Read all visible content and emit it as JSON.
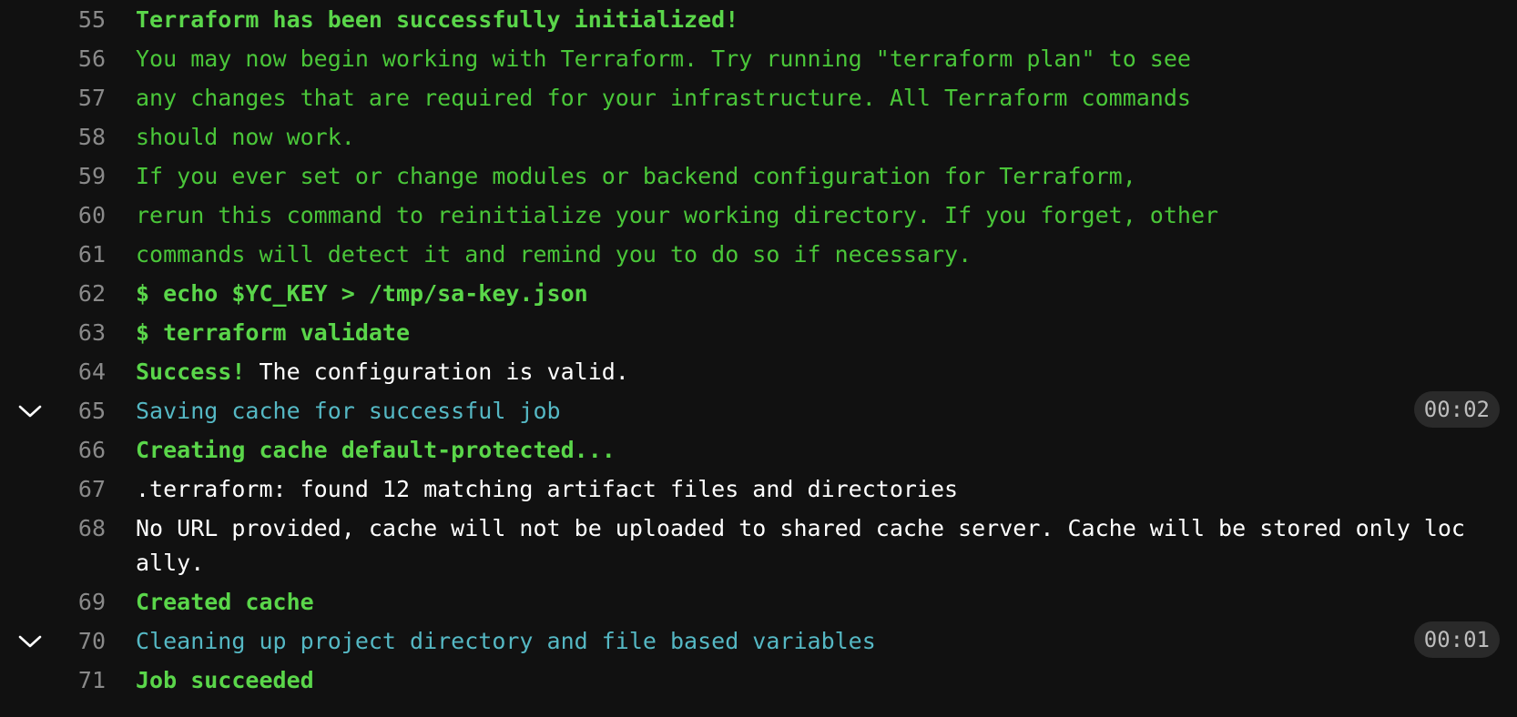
{
  "log": {
    "lines": [
      {
        "num": "55",
        "segments": [
          {
            "text": "Terraform has been successfully initialized!",
            "style": "green-bold"
          }
        ]
      },
      {
        "num": "56",
        "segments": [
          {
            "text": "You may now begin working with Terraform. Try running \"terraform plan\" to see",
            "style": "green"
          }
        ]
      },
      {
        "num": "57",
        "segments": [
          {
            "text": "any changes that are required for your infrastructure. All Terraform commands",
            "style": "green"
          }
        ]
      },
      {
        "num": "58",
        "segments": [
          {
            "text": "should now work.",
            "style": "green"
          }
        ]
      },
      {
        "num": "59",
        "segments": [
          {
            "text": "If you ever set or change modules or backend configuration for Terraform,",
            "style": "green"
          }
        ]
      },
      {
        "num": "60",
        "segments": [
          {
            "text": "rerun this command to reinitialize your working directory. If you forget, other",
            "style": "green"
          }
        ]
      },
      {
        "num": "61",
        "segments": [
          {
            "text": "commands will detect it and remind you to do so if necessary.",
            "style": "green"
          }
        ]
      },
      {
        "num": "62",
        "segments": [
          {
            "text": "$ echo $YC_KEY > /tmp/sa-key.json",
            "style": "green-bold"
          }
        ]
      },
      {
        "num": "63",
        "segments": [
          {
            "text": "$ terraform validate",
            "style": "green-bold"
          }
        ]
      },
      {
        "num": "64",
        "segments": [
          {
            "text": "Success!",
            "style": "green-bold"
          },
          {
            "text": " The configuration is valid.",
            "style": "white"
          }
        ]
      },
      {
        "num": "65",
        "collapsible": true,
        "duration": "00:02",
        "segments": [
          {
            "text": "Saving cache for successful job",
            "style": "cyan"
          }
        ]
      },
      {
        "num": "66",
        "segments": [
          {
            "text": "Creating cache default-protected...",
            "style": "green-bold"
          }
        ]
      },
      {
        "num": "67",
        "segments": [
          {
            "text": ".terraform: found 12 matching artifact files and directories",
            "style": "white"
          }
        ]
      },
      {
        "num": "68",
        "wrap": true,
        "segments": [
          {
            "text": "No URL provided, cache will not be uploaded to shared cache server. Cache will be stored only locally.",
            "style": "white"
          }
        ]
      },
      {
        "num": "69",
        "segments": [
          {
            "text": "Created cache",
            "style": "green-bold"
          }
        ]
      },
      {
        "num": "70",
        "collapsible": true,
        "duration": "00:01",
        "segments": [
          {
            "text": "Cleaning up project directory and file based variables",
            "style": "cyan"
          }
        ]
      },
      {
        "num": "71",
        "segments": [
          {
            "text": "Job succeeded",
            "style": "green-bold"
          }
        ]
      }
    ]
  },
  "icons": {
    "collapse": "chevron-down-icon"
  },
  "colors": {
    "background": "#111111",
    "line_number": "#8a8a8a",
    "green": "#4ac639",
    "cyan": "#55b8c4",
    "duration_badge_bg": "#2a2a2a"
  }
}
